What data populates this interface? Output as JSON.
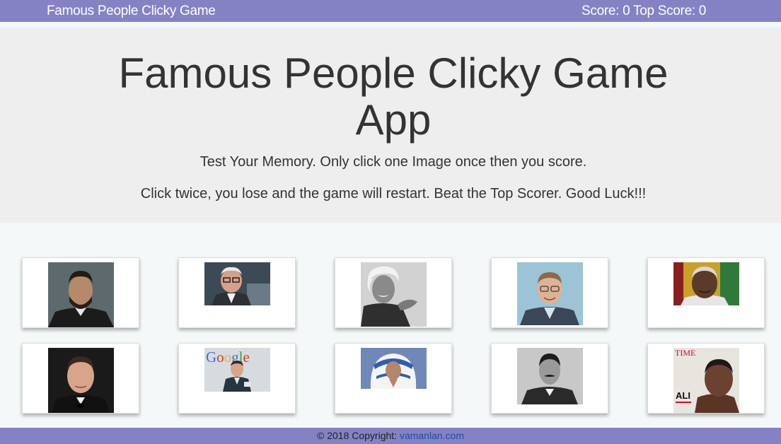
{
  "nav": {
    "brand": "Famous People Clicky Game",
    "score_text": "Score: 0 Top Score: 0"
  },
  "jumbotron": {
    "title": "Famous People Clicky Game App",
    "line1": "Test Your Memory. Only click one Image once then you score.",
    "line2": "Click twice, you lose and the game will restart. Beat the Top Scorer. Good Luck!!!"
  },
  "cards": [
    {
      "name": "Abraham Lincoln portrait"
    },
    {
      "name": "Warren Buffett portrait"
    },
    {
      "name": "Albert Einstein portrait"
    },
    {
      "name": "Bill Gates portrait"
    },
    {
      "name": "Nelson Mandela portrait"
    },
    {
      "name": "Elon Musk portrait"
    },
    {
      "name": "Google founder portrait",
      "caption": "Google"
    },
    {
      "name": "Mother Teresa portrait"
    },
    {
      "name": "Nikola Tesla portrait"
    },
    {
      "name": "Muhammad Ali TIME cover",
      "caption": "TIME",
      "caption2": "ALI"
    }
  ],
  "footer": {
    "prefix": "© 2018 Copyright: ",
    "link": "vamanlan.com"
  },
  "colors": {
    "navbar": "#8582c4",
    "jumbotron": "#eeeeee",
    "link": "#1a4fa0"
  }
}
